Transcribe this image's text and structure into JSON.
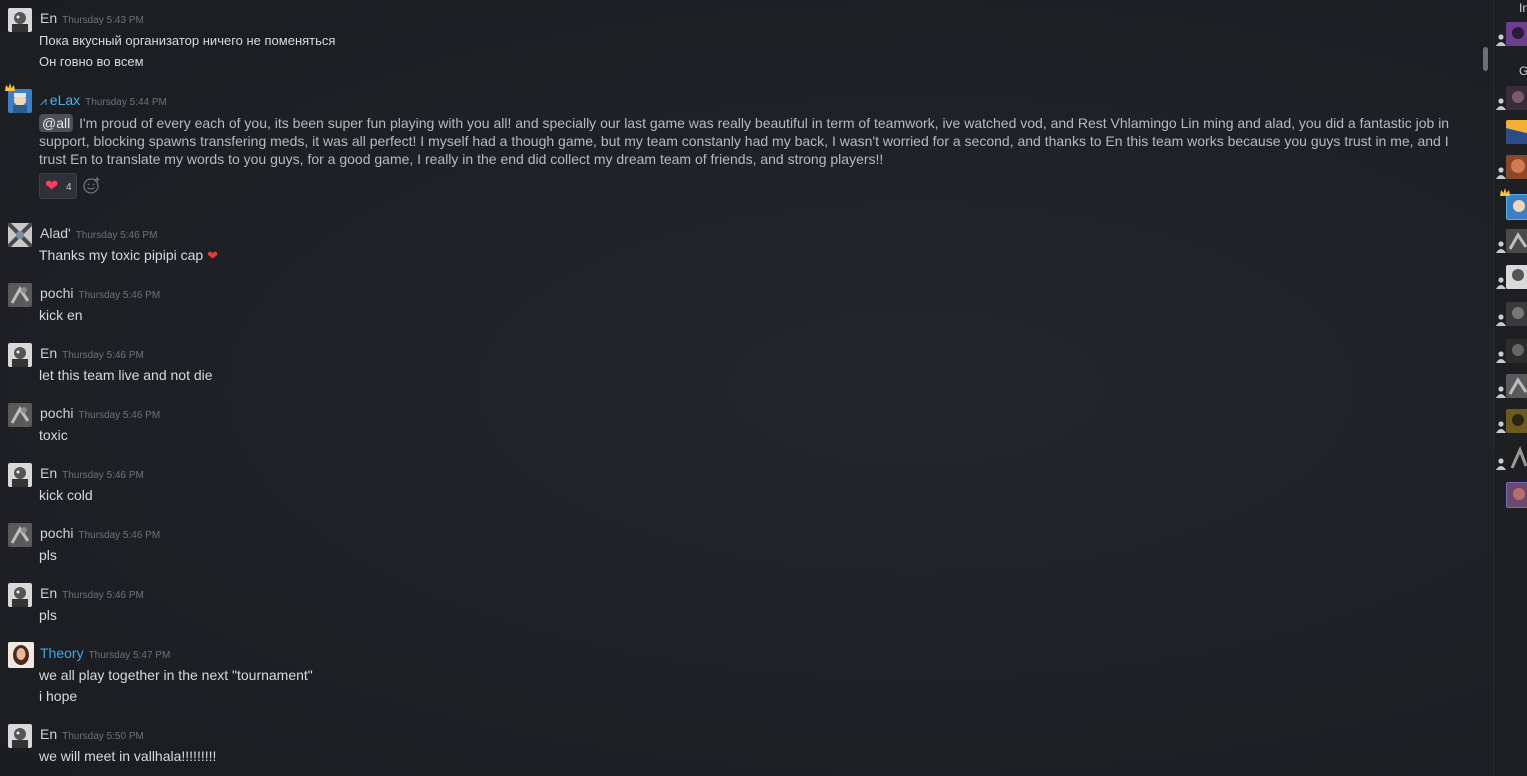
{
  "messages": [
    {
      "name": "En",
      "time": "Thursday 5:43 PM",
      "lines": [
        "Пока вкусный организатор ничего не поменяться",
        "Он говно во всем"
      ]
    },
    {
      "name": "eLax",
      "time": "Thursday 5:44 PM",
      "mention": "@all",
      "text": "I'm proud of every each of you, its been super fun playing with you all! and specially our last game was really beautiful in term of teamwork, ive watched vod, and Rest Vhlamingo Lin ming and alad, you did a fantastic job in support, blocking spawns transfering meds, it was all perfect! I myself had a though game, but my team constanly had my back, I wasn't worried for a second, and thanks to En this team works because you guys trust in me, and I trust En to translate my words to you guys, for a good game, I really in the end did collect my dream team of friends, and strong players!!",
      "reaction": {
        "emoji": "heart-emoji",
        "count": "4"
      }
    },
    {
      "name": "Alad'",
      "time": "Thursday 5:46 PM",
      "lines": [
        "Thanks my toxic pipipi cap"
      ]
    },
    {
      "name": "pochi",
      "time": "Thursday 5:46 PM",
      "lines": [
        "kick en"
      ]
    },
    {
      "name": "En",
      "time": "Thursday 5:46 PM",
      "lines": [
        "let this team live and not die"
      ]
    },
    {
      "name": "pochi",
      "time": "Thursday 5:46 PM",
      "lines": [
        "toxic"
      ]
    },
    {
      "name": "En",
      "time": "Thursday 5:46 PM",
      "lines": [
        "kick cold"
      ]
    },
    {
      "name": "pochi",
      "time": "Thursday 5:46 PM",
      "lines": [
        "pls"
      ]
    },
    {
      "name": "En",
      "time": "Thursday 5:46 PM",
      "lines": [
        "pls"
      ]
    },
    {
      "name": "Theory",
      "time": "Thursday 5:47 PM",
      "lines": [
        "we all play together in the next \"tournament\"",
        "i hope"
      ]
    },
    {
      "name": "En",
      "time": "Thursday 5:50 PM",
      "lines": [
        "we will meet in vallhala!!!!!!!!!"
      ]
    }
  ],
  "sidebar": {
    "group1_label": "In",
    "group2_label": "G"
  },
  "colors": {
    "background": "#1f2126",
    "name_default": "#d0d2d5",
    "name_blue": "#4fb1f0",
    "timestamp": "#6e7278",
    "text": "#d8dadd",
    "heart": "#e43b3b"
  },
  "icons": [
    "crown-icon",
    "heart-emoji",
    "add-reaction-icon",
    "person-icon"
  ]
}
